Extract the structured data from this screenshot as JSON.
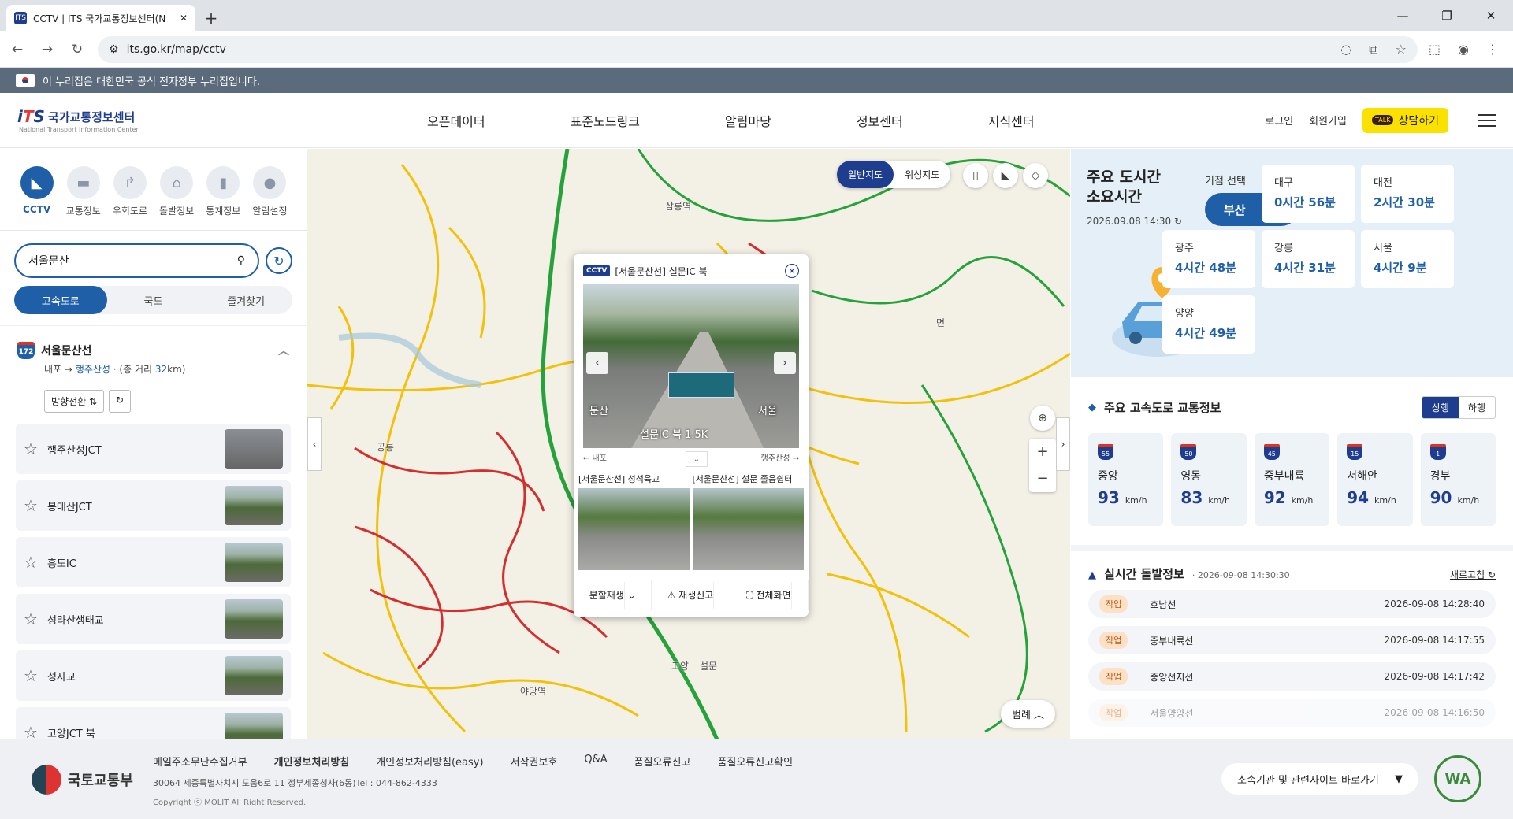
{
  "browser": {
    "tab_title": "CCTV | ITS 국가교통정보센터(N",
    "url": "its.go.kr/map/cctv"
  },
  "gov_banner": "이 누리집은 대한민국 공식 전자정부 누리집입니다.",
  "header": {
    "logo_text": "국가교통정보센터",
    "logo_sub": "National Transport Information Center",
    "nav": [
      "오픈데이터",
      "표준노드링크",
      "알림마당",
      "정보센터",
      "지식센터"
    ],
    "login": "로그인",
    "signup": "회원가입",
    "consult": "상담하기",
    "talk": "TALK"
  },
  "left": {
    "categories": [
      {
        "label": "CCTV",
        "icon": "cctv-icon"
      },
      {
        "label": "교통정보",
        "icon": "car-icon"
      },
      {
        "label": "우회도로",
        "icon": "detour-icon"
      },
      {
        "label": "돌발정보",
        "icon": "incident-icon"
      },
      {
        "label": "통계정보",
        "icon": "stats-icon"
      },
      {
        "label": "알림설정",
        "icon": "alarm-icon"
      }
    ],
    "search_value": "서울문산",
    "segments": [
      "고속도로",
      "국도",
      "즐겨찾기"
    ],
    "route": {
      "number": "172",
      "name": "서울문산선",
      "from": "내포",
      "to": "행주산성",
      "distance_prefix": "(총 거리",
      "distance": "32",
      "distance_suffix": "km)"
    },
    "direction_btn": "방향전환 ⇅",
    "items": [
      "행주산성JCT",
      "봉대산JCT",
      "흥도IC",
      "성라산생태교",
      "성사교",
      "고양JCT 북"
    ]
  },
  "map": {
    "mode_normal": "일반지도",
    "mode_satellite": "위성지도",
    "legend": "범례",
    "labels": [
      "삼릉역",
      "공릉",
      "야당역",
      "고양",
      "설문",
      "면"
    ],
    "popup": {
      "badge": "CCTV",
      "title": "[서울문산선] 설문IC 북",
      "overlay_left": "문산",
      "overlay_right": "서울",
      "overlay_bottom": "설문IC 북 1.5K",
      "dir_left": "← 내포",
      "dir_right": "행주산성 →",
      "sub_cams": [
        "[서울문산선] 성석육교",
        "[서울문산선] 설문 졸음쉼터"
      ],
      "actions": [
        "분할재생",
        "재생신고",
        "전체화면"
      ]
    }
  },
  "right": {
    "commute_title_1": "주요 도시간",
    "commute_title_2": "소요시간",
    "datetime": "2026.09.08 14:30",
    "base_label": "기점 선택",
    "base_value": "부산",
    "cities": [
      {
        "name": "대구",
        "time": "0시간 56분"
      },
      {
        "name": "대전",
        "time": "2시간 30분"
      },
      {
        "name": "광주",
        "time": "4시간 48분"
      },
      {
        "name": "강릉",
        "time": "4시간 31분"
      },
      {
        "name": "서울",
        "time": "4시간 9분"
      },
      {
        "name": "양양",
        "time": "4시간 49분"
      }
    ],
    "highway_title": "주요 고속도로 교통정보",
    "highway_toggle": [
      "상행",
      "하행"
    ],
    "highways": [
      {
        "no": "55",
        "name": "중앙",
        "speed": "93",
        "unit": "km/h"
      },
      {
        "no": "50",
        "name": "영동",
        "speed": "83",
        "unit": "km/h"
      },
      {
        "no": "45",
        "name": "중부내륙",
        "speed": "92",
        "unit": "km/h"
      },
      {
        "no": "15",
        "name": "서해안",
        "speed": "94",
        "unit": "km/h"
      },
      {
        "no": "1",
        "name": "경부",
        "speed": "90",
        "unit": "km/h"
      }
    ],
    "incident_title": "실시간 돌발정보",
    "incident_time": "· 2026-09-08 14:30:30",
    "refresh": "새로고침",
    "incidents": [
      {
        "tag": "작업",
        "name": "호남선",
        "time": "2026-09-08 14:28:40"
      },
      {
        "tag": "작업",
        "name": "중부내륙선",
        "time": "2026-09-08 14:17:55"
      },
      {
        "tag": "작업",
        "name": "중앙선지선",
        "time": "2026-09-08 14:17:42"
      },
      {
        "tag": "작업",
        "name": "서울양양선",
        "time": "2026-09-08 14:16:50"
      }
    ]
  },
  "footer": {
    "org": "국토교통부",
    "links": [
      "메일주소무단수집거부",
      "개인정보처리방침",
      "개인정보처리방침(easy)",
      "저작권보호",
      "Q&A",
      "품질오류신고",
      "품질오류신고확인"
    ],
    "address": "30064 세종특별자치시 도움6로 11 정부세종청사(6동)Tel : 044-862-4333",
    "copyright": "Copyright ⓒ MOLIT All Right Reserved.",
    "related": "소속기관 및 관련사이트 바로가기",
    "wa": "WA"
  }
}
